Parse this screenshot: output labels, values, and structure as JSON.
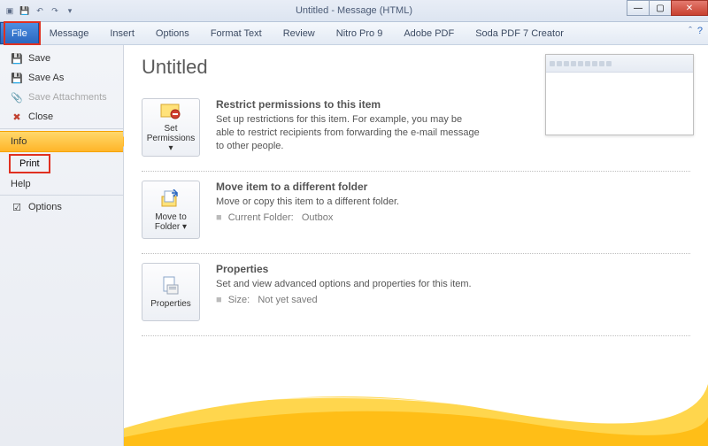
{
  "window": {
    "title": "Untitled - Message (HTML)"
  },
  "ribbon": {
    "file": "File",
    "tabs": [
      "Message",
      "Insert",
      "Options",
      "Format Text",
      "Review",
      "Nitro Pro 9",
      "Adobe PDF",
      "Soda PDF 7 Creator"
    ]
  },
  "sidebar": {
    "save": "Save",
    "saveas": "Save As",
    "saveatt": "Save Attachments",
    "close": "Close",
    "info": "Info",
    "print": "Print",
    "help": "Help",
    "options": "Options"
  },
  "main": {
    "title": "Untitled",
    "sections": [
      {
        "button": "Set Permissions",
        "title": "Restrict permissions to this item",
        "desc": "Set up restrictions for this item. For example, you may be able to restrict recipients from forwarding the e-mail message to other people."
      },
      {
        "button": "Move to Folder",
        "title": "Move item to a different folder",
        "desc": "Move or copy this item to a different folder.",
        "meta_label": "Current Folder:",
        "meta_value": "Outbox"
      },
      {
        "button": "Properties",
        "title": "Properties",
        "desc": "Set and view advanced options and properties for this item.",
        "meta_label": "Size:",
        "meta_value": "Not yet saved"
      }
    ]
  }
}
